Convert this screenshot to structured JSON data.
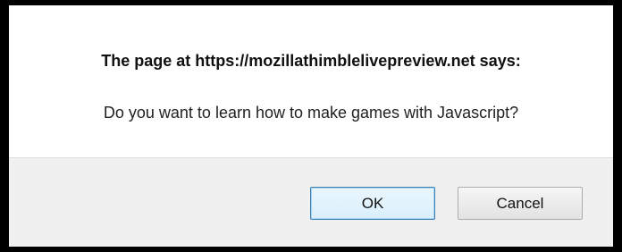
{
  "dialog": {
    "heading": "The page at https://mozillathimblelivepreview.net says:",
    "message": "Do you want to learn how to make games with Javascript?",
    "ok_label": "OK",
    "cancel_label": "Cancel"
  },
  "colors": {
    "footer_background": "#f0f0f0",
    "ok_border": "#3c7fb1",
    "frame": "#000000"
  }
}
